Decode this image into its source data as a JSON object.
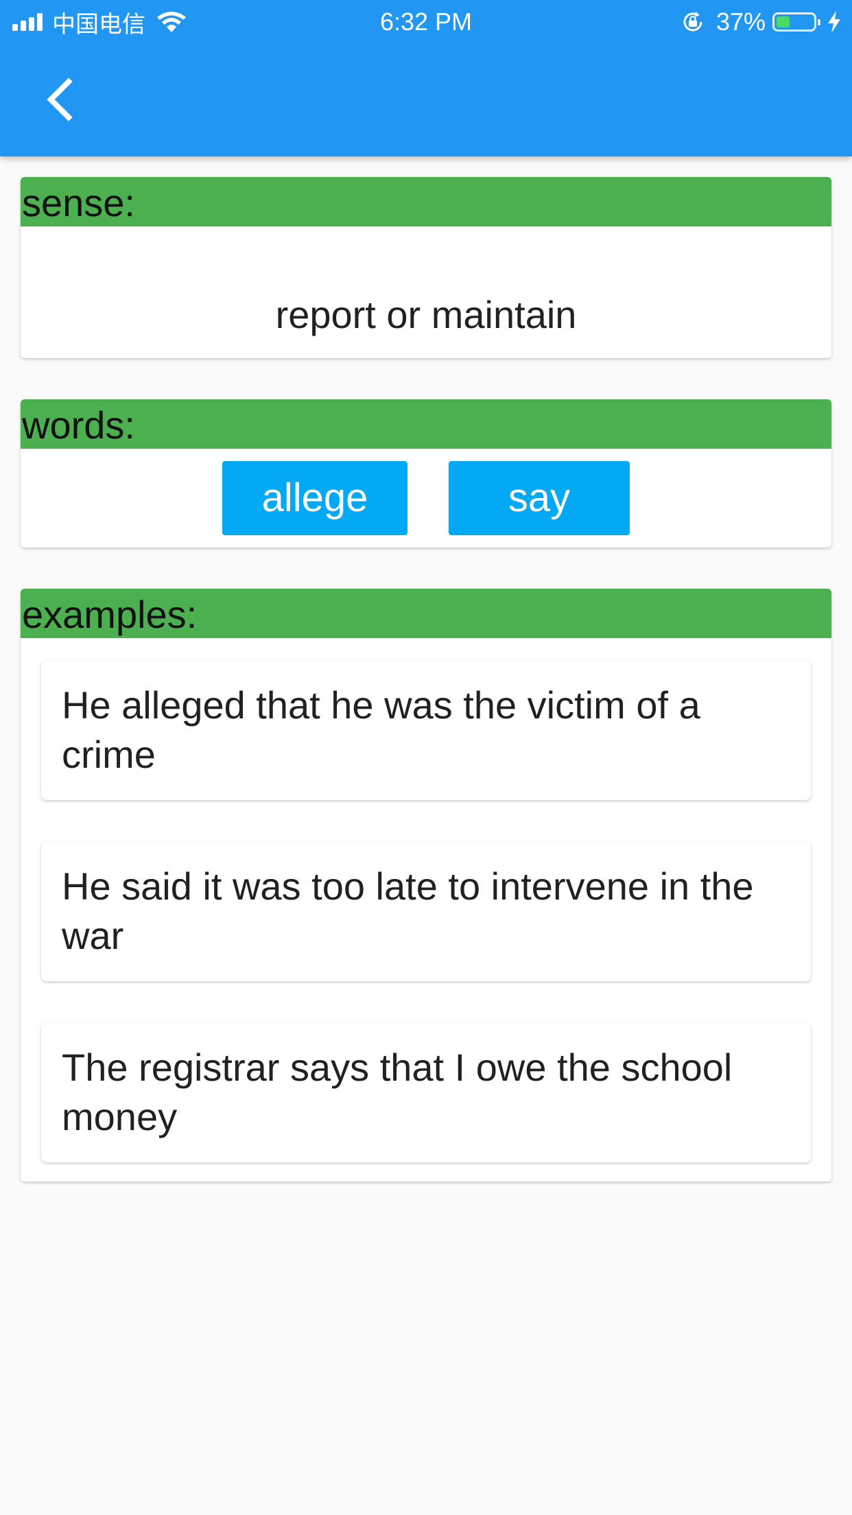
{
  "status_bar": {
    "carrier": "中国电信",
    "time": "6:32 PM",
    "battery_percent": "37%",
    "battery_level": 0.37,
    "icons": [
      "signal-icon",
      "wifi-icon",
      "orientation-lock-icon",
      "battery-icon",
      "charging-icon"
    ]
  },
  "app_bar": {
    "back_icon": "chevron-left-icon",
    "color": "#2196f3"
  },
  "sense_card": {
    "header": "sense:",
    "text": "report or maintain"
  },
  "words_card": {
    "header": "words:",
    "words": [
      "allege",
      "say"
    ]
  },
  "examples_card": {
    "header": "examples:",
    "items": [
      "He alleged that he was the victim of a crime",
      "He said it was too late to intervene in the war",
      "The registrar says that I owe the school money"
    ]
  },
  "colors": {
    "header_green": "#4caf50",
    "chip_blue": "#03a9f4",
    "background": "#fafafa"
  }
}
